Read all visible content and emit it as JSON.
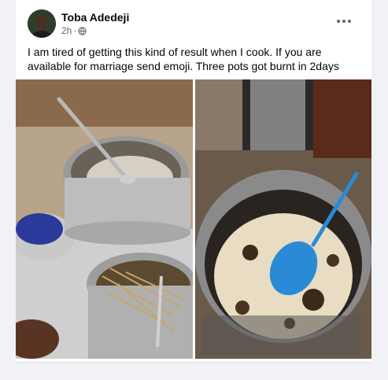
{
  "post": {
    "author": "Toba Adedeji",
    "time": "2h",
    "privacy_icon": "globe-icon",
    "text": "I am tired of getting this kind of result when I cook. If you are available for marriage send emoji. Three pots got burnt in 2days",
    "photos": [
      {
        "label": "kitchen-sink-pots"
      },
      {
        "label": "burnt-rice-pot"
      }
    ]
  },
  "colors": {
    "name": "#050505",
    "meta": "#65676b",
    "background": "#f0f2f5"
  }
}
